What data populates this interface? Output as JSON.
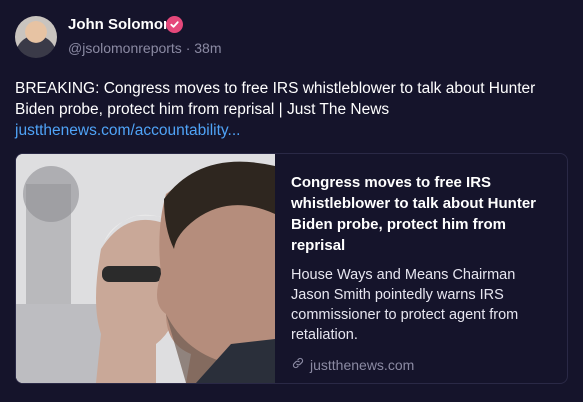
{
  "author": {
    "name": "John Solomon",
    "handle": "@jsolomonreports",
    "separator": "·",
    "timestamp": "38m"
  },
  "post": {
    "text": "BREAKING: Congress moves to free IRS whistleblower to talk about Hunter Biden probe, protect him from reprisal | Just The News",
    "link_text": "justthenews.com/accountability..."
  },
  "card": {
    "title": "Congress moves to free IRS whistleblower to talk about Hunter Biden probe, protect him from reprisal",
    "description": "House Ways and Means Chairman Jason Smith pointedly warns IRS commissioner to protect agent from retaliation.",
    "domain": "justthenews.com",
    "domain_icon": "link-icon"
  },
  "colors": {
    "background": "#15142b",
    "link": "#4fa3f7",
    "verified_badge": "#e5487b",
    "muted": "#8b8aa3"
  }
}
